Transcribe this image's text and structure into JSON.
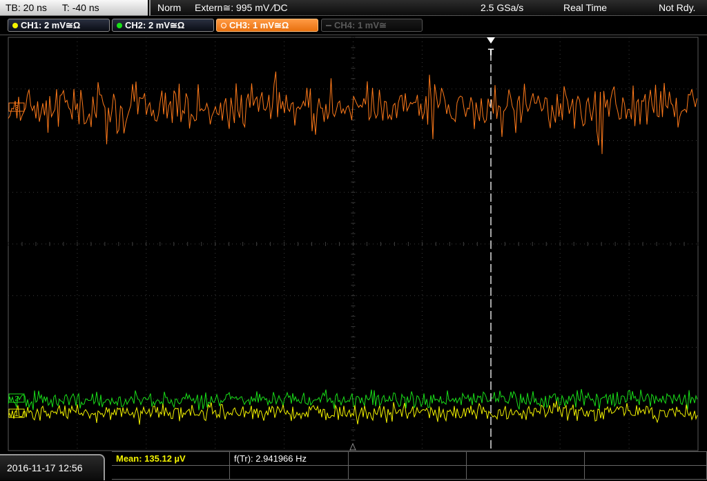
{
  "top_left": {
    "timebase": "TB: 20 ns",
    "trigger_offset": "T: -40 ns"
  },
  "top_right": {
    "mode": "Norm",
    "trigger": "Extern≅: 995 mV ∕DC",
    "sample_rate": "2.5 GSa/s",
    "acq_mode": "Real Time",
    "status": "Not Rdy."
  },
  "channels": [
    {
      "label": "CH1: 2 mV≅Ω",
      "color": "#f4f400",
      "active": true
    },
    {
      "label": "CH2: 2 mV≅Ω",
      "color": "#19e019",
      "active": true
    },
    {
      "label": "CH3: 1 mV≅Ω",
      "color": "#ff8a2a",
      "active": true
    },
    {
      "label": "CH4: 1 mV≅",
      "color": "#555555",
      "active": false
    }
  ],
  "markers": {
    "trigger": "T",
    "ch3": "3",
    "ch2": "2",
    "ch1": "1"
  },
  "measurements": {
    "mean": "Mean: 135.12 µV",
    "freq": "f(Tr): 2.941966 Hz"
  },
  "datetime": "2016-11-17 12:56",
  "colors": {
    "ch1": "#f4f400",
    "ch2": "#19e019",
    "ch3": "#ff7a1a",
    "grid": "#3c3c3c",
    "background": "#000000"
  }
}
